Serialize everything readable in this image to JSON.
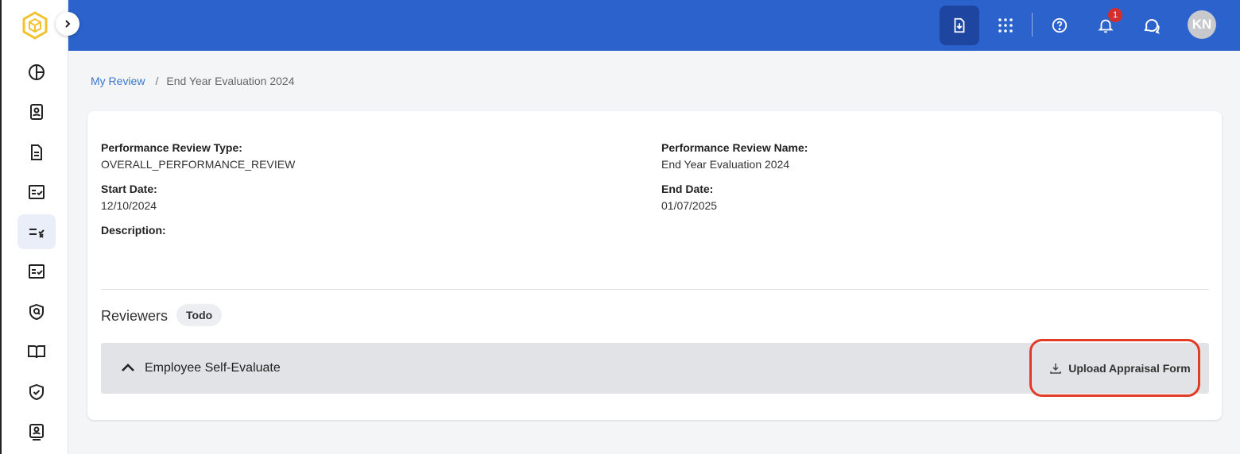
{
  "header": {
    "notification_count": "1",
    "avatar_initials": "KN",
    "color": "#2b62cb"
  },
  "sidebar": {
    "items": [
      {
        "icon": "pie-chart-icon"
      },
      {
        "icon": "contact-card-icon"
      },
      {
        "icon": "document-icon"
      },
      {
        "icon": "checklist-icon"
      },
      {
        "icon": "list-check-icon",
        "active": true
      },
      {
        "icon": "checklist-icon"
      },
      {
        "icon": "shield-search-icon"
      },
      {
        "icon": "book-icon"
      },
      {
        "icon": "shield-check-icon"
      },
      {
        "icon": "user-badge-icon"
      }
    ]
  },
  "breadcrumb": {
    "root": "My Review",
    "separator": "/",
    "current": "End Year Evaluation 2024"
  },
  "review": {
    "type_label": "Performance Review Type:",
    "type_value": "OVERALL_PERFORMANCE_REVIEW",
    "name_label": "Performance Review Name:",
    "name_value": "End Year Evaluation 2024",
    "start_label": "Start Date:",
    "start_value": "12/10/2024",
    "end_label": "End Date:",
    "end_value": "01/07/2025",
    "description_label": "Description:"
  },
  "reviewers": {
    "title": "Reviewers",
    "status": "Todo",
    "section_title": "Employee Self-Evaluate",
    "upload_label": "Upload Appraisal Form"
  }
}
